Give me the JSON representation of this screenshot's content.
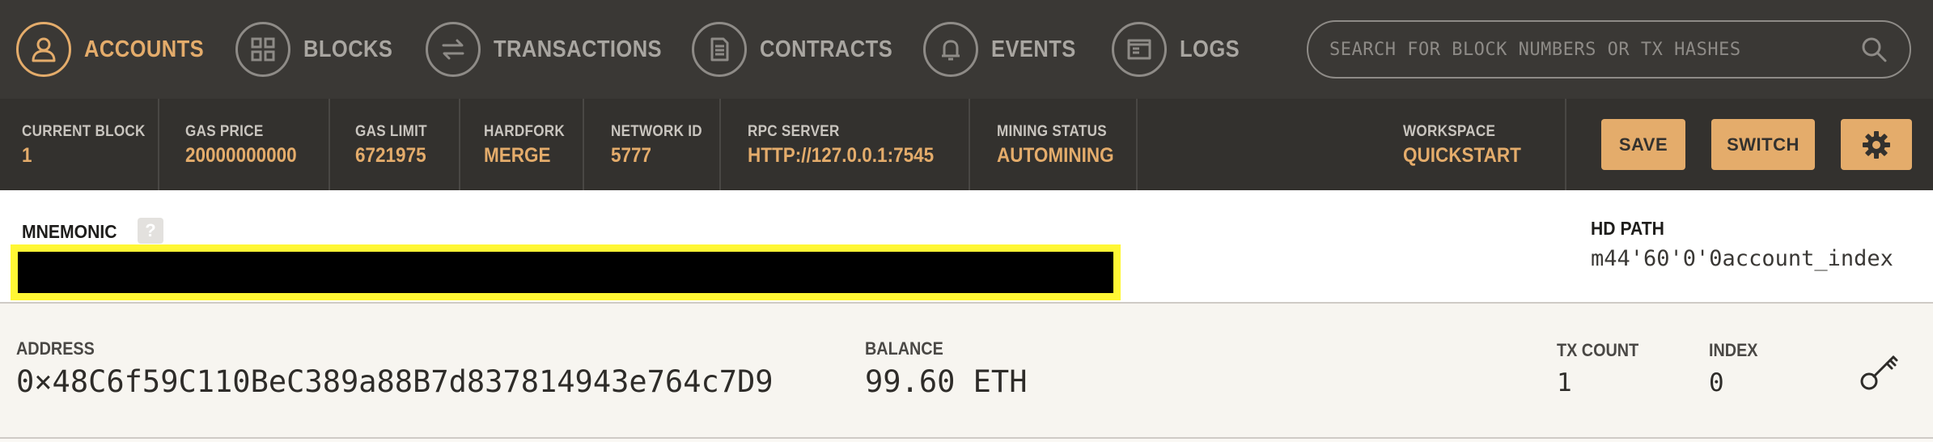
{
  "nav": {
    "tabs": [
      {
        "label": "ACCOUNTS",
        "icon": "person-icon",
        "active": true
      },
      {
        "label": "BLOCKS",
        "icon": "blocks-grid-icon",
        "active": false
      },
      {
        "label": "TRANSACTIONS",
        "icon": "arrows-exchange-icon",
        "active": false
      },
      {
        "label": "CONTRACTS",
        "icon": "document-icon",
        "active": false
      },
      {
        "label": "EVENTS",
        "icon": "bell-icon",
        "active": false
      },
      {
        "label": "LOGS",
        "icon": "terminal-icon",
        "active": false
      }
    ],
    "search": {
      "placeholder": "SEARCH FOR BLOCK NUMBERS OR TX HASHES",
      "value": "",
      "icon": "search-icon"
    }
  },
  "status": {
    "current_block": {
      "label": "CURRENT BLOCK",
      "value": "1"
    },
    "gas_price": {
      "label": "GAS PRICE",
      "value": "20000000000"
    },
    "gas_limit": {
      "label": "GAS LIMIT",
      "value": "6721975"
    },
    "hardfork": {
      "label": "HARDFORK",
      "value": "MERGE"
    },
    "network_id": {
      "label": "NETWORK ID",
      "value": "5777"
    },
    "rpc_server": {
      "label": "RPC SERVER",
      "value": "HTTP://127.0.0.1:7545"
    },
    "mining_status": {
      "label": "MINING STATUS",
      "value": "AUTOMINING"
    },
    "workspace": {
      "label": "WORKSPACE",
      "value": "QUICKSTART"
    }
  },
  "buttons": {
    "save": "SAVE",
    "switch": "SWITCH",
    "settings_icon": "gear-icon"
  },
  "mnemonic": {
    "label": "MNEMONIC",
    "help": "?",
    "value": ""
  },
  "hd_path": {
    "label": "HD PATH",
    "value": "m44'60'0'0account_index"
  },
  "account": {
    "address_label": "ADDRESS",
    "address": "0×48C6f59C110BeC389a88B7d837814943e764c7D9",
    "balance_label": "BALANCE",
    "balance": "99.60 ETH",
    "tx_count_label": "TX COUNT",
    "tx_count": "1",
    "index_label": "INDEX",
    "index": "0",
    "key_icon": "key-icon"
  },
  "colors": {
    "accent": "#e4ac6b",
    "nav_bg": "#3a3835",
    "status_bg": "#33312e",
    "highlight": "#fff734"
  }
}
